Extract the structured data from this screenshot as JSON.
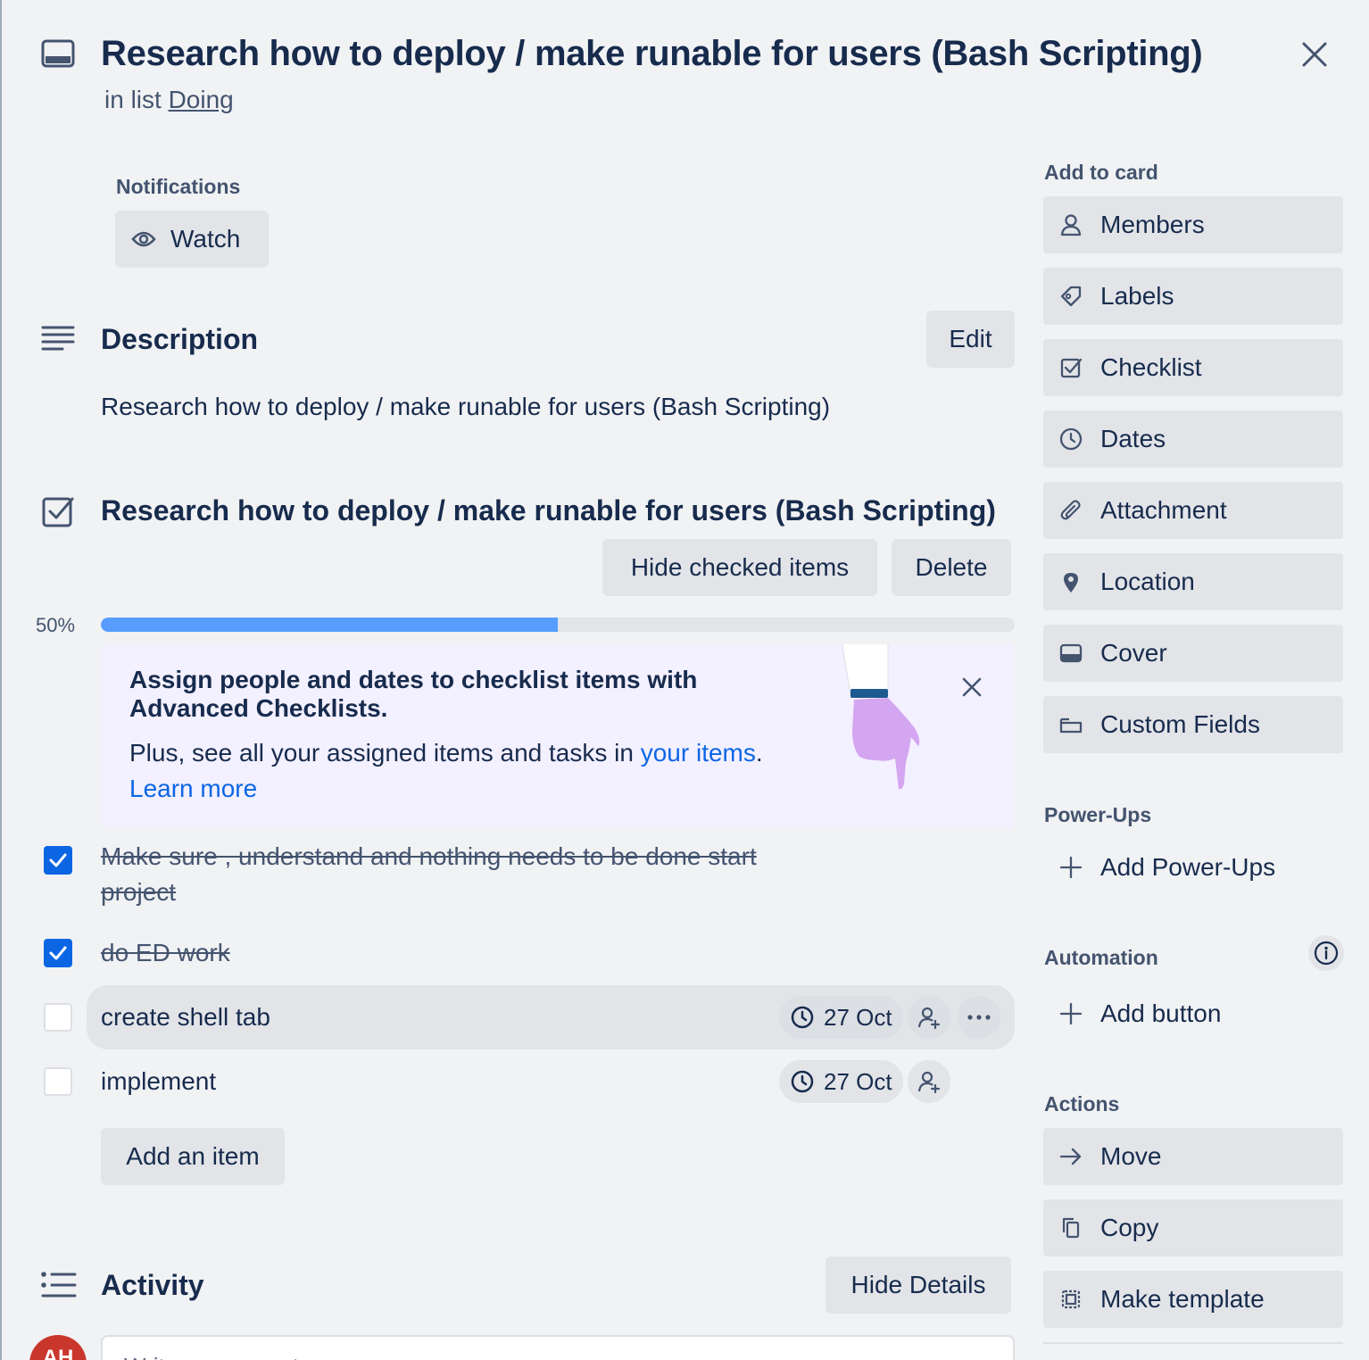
{
  "card": {
    "title": "Research how to deploy / make runable for users (Bash Scripting)",
    "in_list_prefix": "in list",
    "list_name": "Doing"
  },
  "notifications": {
    "label": "Notifications",
    "watch_label": "Watch"
  },
  "description": {
    "heading": "Description",
    "edit_label": "Edit",
    "text": "Research how to deploy / make runable for users (Bash Scripting)"
  },
  "checklist": {
    "title": "Research how to deploy / make runable for users (Bash Scripting)",
    "hide_checked_label": "Hide checked items",
    "delete_label": "Delete",
    "progress_text": "50%",
    "progress_value": 0.5,
    "promo": {
      "title": "Assign people and dates to checklist items with Advanced Checklists.",
      "body_prefix": "Plus, see all your assigned items and tasks in ",
      "body_link": "your items",
      "body_suffix": ".",
      "learn_more": "Learn more"
    },
    "items": [
      {
        "text": "Make sure , understand and nothing needs to be done start project",
        "checked": true
      },
      {
        "text": "do ED work",
        "checked": true
      },
      {
        "text": "create shell tab",
        "checked": false,
        "due": "27 Oct"
      },
      {
        "text": "implement",
        "checked": false,
        "due": "27 Oct"
      }
    ],
    "add_item_label": "Add an item"
  },
  "activity": {
    "heading": "Activity",
    "hide_details_label": "Hide Details",
    "avatar_initials": "AH",
    "comment_placeholder": "Write a comment..."
  },
  "sidebar": {
    "add_to_card_label": "Add to card",
    "add_to_card": [
      {
        "label": "Members",
        "icon": "person-icon"
      },
      {
        "label": "Labels",
        "icon": "tag-icon"
      },
      {
        "label": "Checklist",
        "icon": "checkbox-icon"
      },
      {
        "label": "Dates",
        "icon": "clock-icon"
      },
      {
        "label": "Attachment",
        "icon": "paperclip-icon"
      },
      {
        "label": "Location",
        "icon": "pin-icon"
      },
      {
        "label": "Cover",
        "icon": "cover-icon"
      },
      {
        "label": "Custom Fields",
        "icon": "field-icon"
      }
    ],
    "powerups_label": "Power-Ups",
    "add_powerups_label": "Add Power-Ups",
    "automation_label": "Automation",
    "add_button_label": "Add button",
    "actions_label": "Actions",
    "actions": [
      {
        "label": "Move",
        "icon": "arrow-right-icon"
      },
      {
        "label": "Copy",
        "icon": "copy-icon"
      },
      {
        "label": "Make template",
        "icon": "template-icon"
      }
    ]
  },
  "colors": {
    "accent": "#0c66e4",
    "progress": "#579dff",
    "background": "#f1f2f4",
    "button": "#e2e4e8",
    "promo_bg": "#f3f0ff",
    "avatar": "#c9372c"
  }
}
